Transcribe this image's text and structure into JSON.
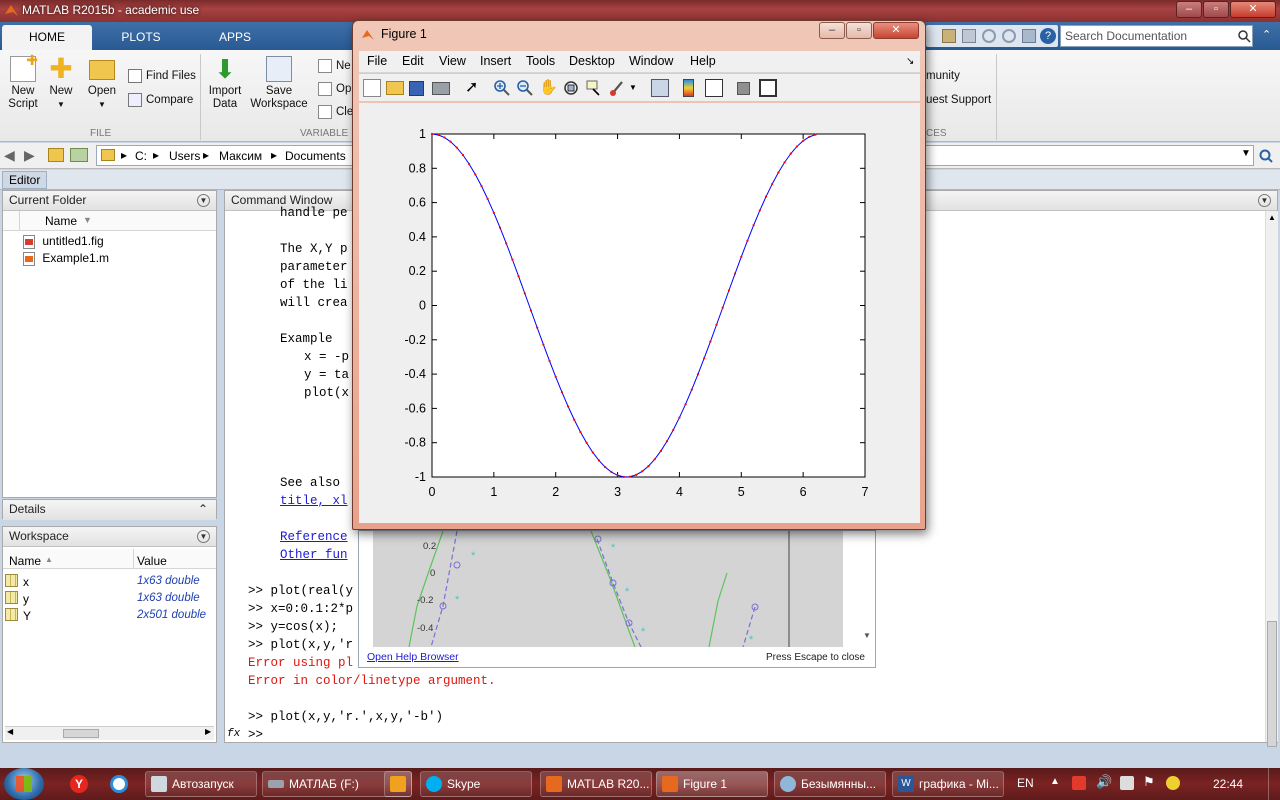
{
  "app": {
    "title": "MATLAB R2015b - academic use",
    "search_placeholder": "Search Documentation"
  },
  "ribbon": {
    "tabs": [
      "HOME",
      "PLOTS",
      "APPS"
    ],
    "file_group": {
      "new_script": [
        "New",
        "Script"
      ],
      "new": "New",
      "open": "Open",
      "find_files": "Find Files",
      "compare": "Compare",
      "label": "FILE"
    },
    "variable_group": {
      "import_data": [
        "Import",
        "Data"
      ],
      "save_workspace": [
        "Save",
        "Workspace"
      ],
      "new_var": "Ne",
      "open_var": "Op",
      "clear": "Cle",
      "label": "VARIABLE"
    },
    "resources": {
      "community": "munity",
      "support": "uest Support",
      "label": "CES"
    }
  },
  "address": {
    "path": [
      "C:",
      "Users",
      "Максим",
      "Documents"
    ]
  },
  "editor_bar": "Editor",
  "current_folder": {
    "title": "Current Folder",
    "column": "Name",
    "files": [
      "untitled1.fig",
      "Example1.m"
    ]
  },
  "details": {
    "title": "Details"
  },
  "workspace": {
    "title": "Workspace",
    "columns": [
      "Name",
      "Value"
    ],
    "vars": [
      {
        "name": "x",
        "value": "1x63 double"
      },
      {
        "name": "y",
        "value": "1x63 double"
      },
      {
        "name": "Y",
        "value": "2x501 double"
      }
    ]
  },
  "command_window": {
    "title": "Command Window",
    "help_lines": [
      "handle pe",
      "The X,Y p",
      "parameter",
      "of the li",
      "will crea",
      "Example",
      "x = -p",
      "y = ta",
      "plot(x",
      "See also",
      "title, xl",
      "Reference",
      "Other fun"
    ],
    "history": [
      ">> plot(real(y",
      ">> x=0:0.1:2*p",
      ">> y=cos(x);",
      ">> plot(x,y,'r"
    ],
    "errors": [
      "Error using pl",
      "Error in color/linetype argument."
    ],
    "last_cmd": ">> plot(x,y,'r.',x,y,'-b')",
    "prompt": ">>",
    "fx": "fx"
  },
  "help_popup": {
    "open_help": "Open Help Browser",
    "escape": "Press Escape to close",
    "yticks": [
      "0.2",
      "0",
      "-0.2",
      "-0.4"
    ]
  },
  "figure": {
    "title": "Figure 1",
    "menus": [
      "File",
      "Edit",
      "View",
      "Insert",
      "Tools",
      "Desktop",
      "Window",
      "Help"
    ]
  },
  "chart_data": {
    "type": "line",
    "title": "",
    "xlabel": "",
    "ylabel": "",
    "xlim": [
      0,
      7
    ],
    "ylim": [
      -1,
      1
    ],
    "xticks": [
      0,
      1,
      2,
      3,
      4,
      5,
      6,
      7
    ],
    "yticks": [
      1,
      0.8,
      0.6,
      0.4,
      0.2,
      0,
      -0.2,
      -0.4,
      -0.6,
      -0.8,
      -1
    ],
    "grid": false,
    "legend": "none",
    "x": "0:0.1:6.2",
    "series": [
      {
        "style": "r.",
        "color": "#ff0000",
        "values": [
          1.0,
          0.995,
          0.9801,
          0.9553,
          0.9211,
          0.8776,
          0.8253,
          0.7648,
          0.6967,
          0.6216,
          0.5403,
          0.4536,
          0.3624,
          0.2675,
          0.17,
          0.0707,
          -0.0292,
          -0.1288,
          -0.2272,
          -0.3233,
          -0.4161,
          -0.5048,
          -0.5885,
          -0.6663,
          -0.7374,
          -0.8011,
          -0.8569,
          -0.904,
          -0.9422,
          -0.971,
          -0.99,
          -0.9991,
          -0.9983,
          -0.9875,
          -0.9668,
          -0.9365,
          -0.8968,
          -0.8481,
          -0.791,
          -0.7259,
          -0.6536,
          -0.5748,
          -0.4903,
          -0.4008,
          -0.3073,
          -0.2108,
          -0.1122,
          -0.0124,
          0.0875,
          0.1865,
          0.2837,
          0.378,
          0.4685,
          0.5544,
          0.6347,
          0.7087,
          0.7756,
          0.8347,
          0.8855,
          0.9275,
          0.9602,
          0.9833,
          0.9965
        ]
      },
      {
        "style": "-b",
        "color": "#0000ff",
        "values": "same as previous series"
      }
    ]
  },
  "taskbar": {
    "items": [
      "Автозапуск",
      "МАТЛАБ (F:)",
      "",
      "Skype",
      "MATLAB R20...",
      "Figure 1",
      "Безымянны...",
      "графика - Mi..."
    ],
    "lang": "EN",
    "clock": "22:44"
  }
}
